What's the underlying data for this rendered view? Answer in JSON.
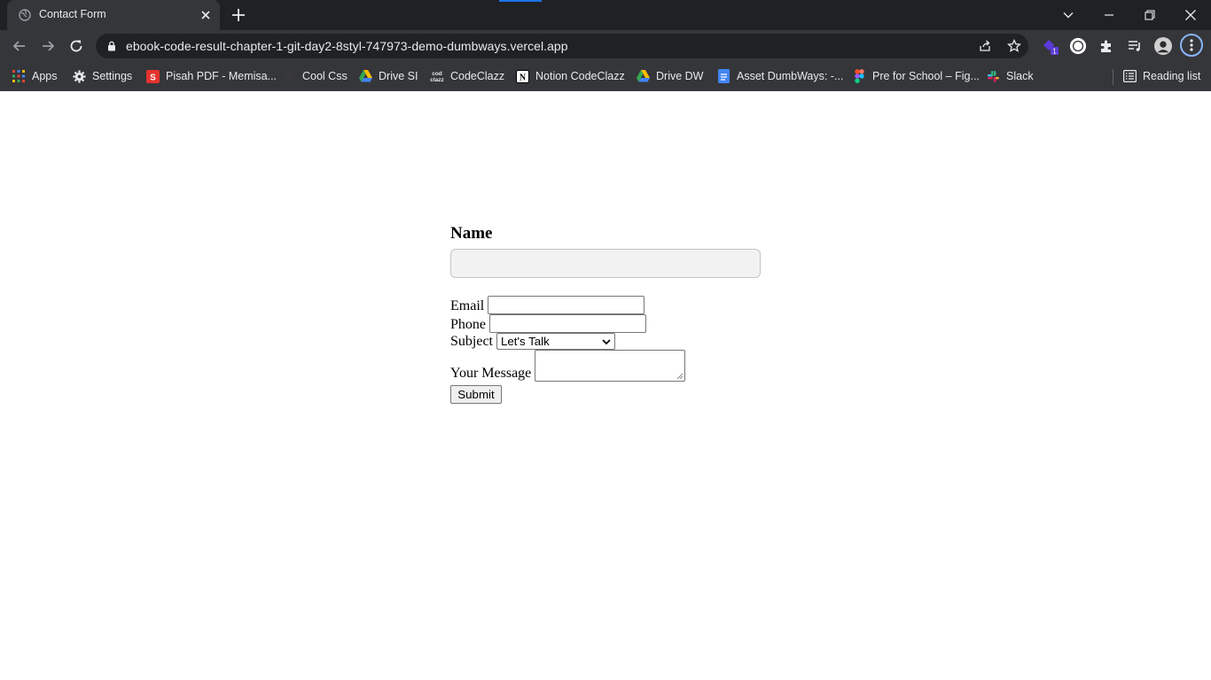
{
  "browser": {
    "tab_title": "Contact Form",
    "url": "ebook-code-result-chapter-1-git-day2-8styl-747973-demo-dumbways.vercel.app",
    "extension_badge": "1",
    "accent_color": "#8ab4f8"
  },
  "bookmarks": {
    "items": [
      {
        "label": "Apps",
        "icon": "apps-grid-icon"
      },
      {
        "label": "Settings",
        "icon": "gear-icon"
      },
      {
        "label": "Pisah PDF - Memisa...",
        "icon": "pdf-icon"
      },
      {
        "label": "Cool Css",
        "icon": "css-icon"
      },
      {
        "label": "Drive SI",
        "icon": "google-drive-icon"
      },
      {
        "label": "CodeClazz",
        "icon": "codeclazz-icon"
      },
      {
        "label": "Notion CodeClazz",
        "icon": "notion-icon"
      },
      {
        "label": "Drive DW",
        "icon": "google-drive-icon"
      },
      {
        "label": "Asset DumbWays: -...",
        "icon": "google-docs-icon"
      },
      {
        "label": "Pre for School – Fig...",
        "icon": "figma-icon"
      },
      {
        "label": "Slack",
        "icon": "slack-icon"
      }
    ],
    "reading_list": "Reading list"
  },
  "form": {
    "name_label": "Name",
    "name_value": "",
    "email_label": "Email",
    "email_value": "",
    "phone_label": "Phone",
    "phone_value": "",
    "subject_label": "Subject",
    "subject_selected": "Let's Talk",
    "message_label": "Your Message",
    "message_value": "",
    "submit_label": "Submit"
  }
}
